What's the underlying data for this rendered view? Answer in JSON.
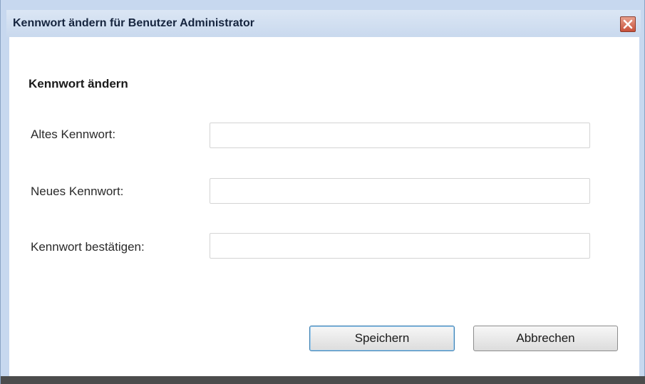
{
  "window": {
    "title": "Kennwort ändern für Benutzer Administrator",
    "close_icon": "close-icon"
  },
  "form": {
    "section_title": "Kennwort ändern",
    "fields": [
      {
        "label": "Altes Kennwort:",
        "value": ""
      },
      {
        "label": "Neues Kennwort:",
        "value": ""
      },
      {
        "label": "Kennwort bestätigen:",
        "value": ""
      }
    ]
  },
  "buttons": {
    "save_label": "Speichern",
    "cancel_label": "Abbrechen"
  },
  "colors": {
    "titlebar": "#c9d9ee",
    "close_button": "#c8503a",
    "primary_button_border": "#3c7fb1"
  }
}
